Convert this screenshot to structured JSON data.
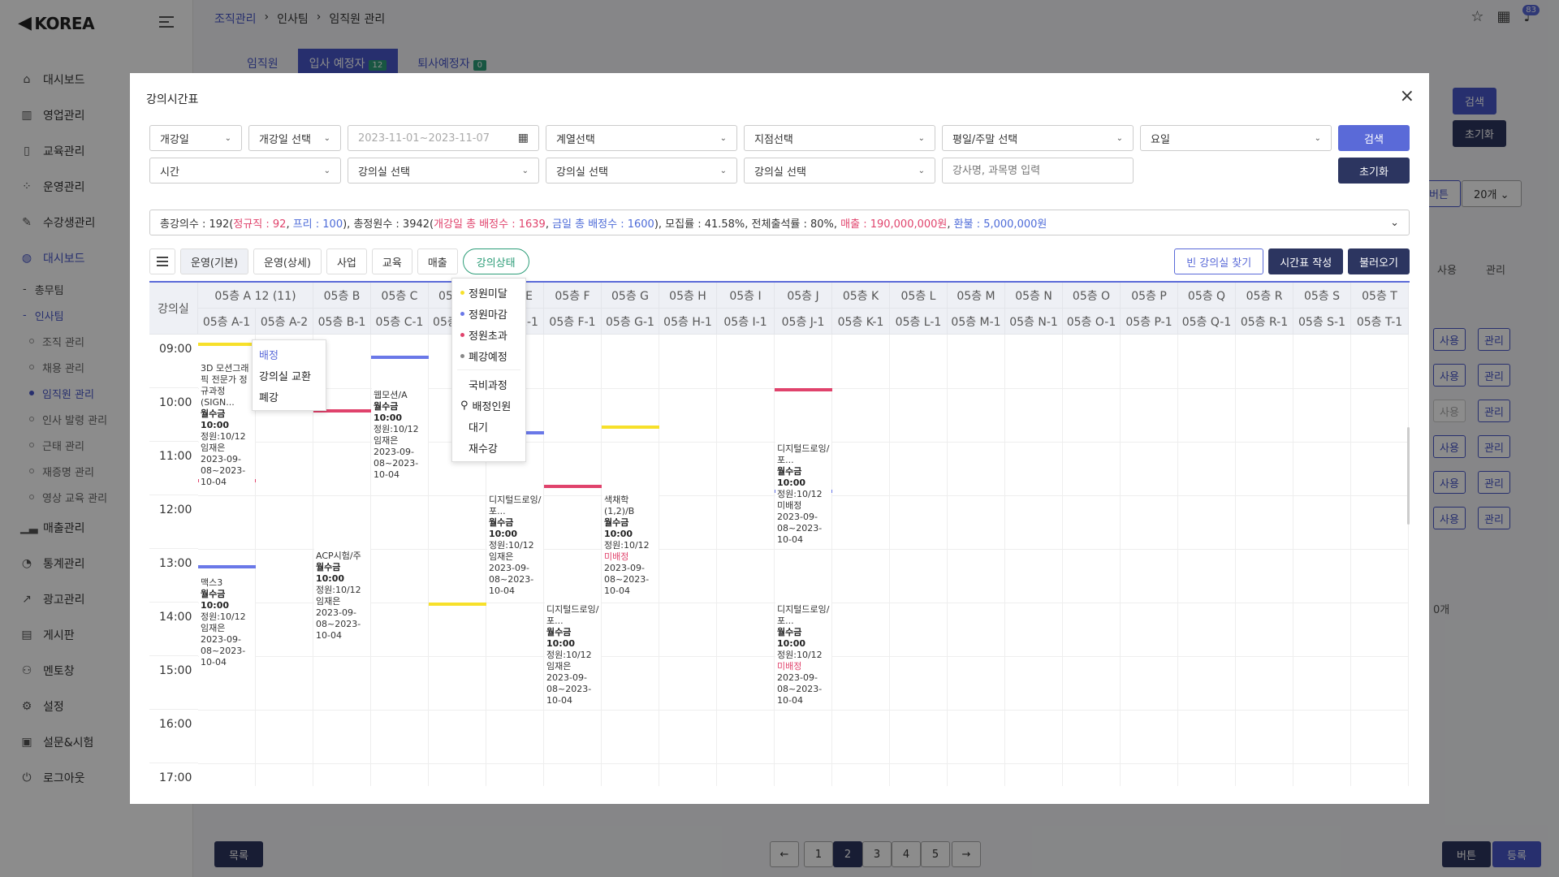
{
  "app": {
    "logo": "KOREA"
  },
  "breadcrumb": [
    "조직관리",
    "인사팀",
    "임직원 관리"
  ],
  "notifications": "83",
  "sidebar": {
    "items": [
      {
        "label": "대시보드",
        "icon": "home-icon"
      },
      {
        "label": "영업관리",
        "icon": "building-icon"
      },
      {
        "label": "교육관리",
        "icon": "book-icon"
      },
      {
        "label": "운영관리",
        "icon": "grid-icon"
      },
      {
        "label": "수강생관리",
        "icon": "edit-icon"
      },
      {
        "label": "대시보드",
        "icon": "globe-icon"
      }
    ],
    "sub": [
      "총무팀",
      "인사팀"
    ],
    "subsub": [
      "조직 관리",
      "채용 관리",
      "임직원 관리",
      "인사 발령 관리",
      "근태 관리",
      "재증명 관리",
      "영상 교육 관리"
    ],
    "items2": [
      {
        "label": "매출관리",
        "icon": "bar-chart-icon"
      },
      {
        "label": "통계관리",
        "icon": "pie-icon"
      },
      {
        "label": "광고관리",
        "icon": "trend-icon"
      },
      {
        "label": "게시판",
        "icon": "board-icon"
      },
      {
        "label": "멘토창",
        "icon": "people-icon"
      },
      {
        "label": "설정",
        "icon": "gear-icon"
      },
      {
        "label": "설문&시험",
        "icon": "survey-icon"
      },
      {
        "label": "로그아웃",
        "icon": "power-icon"
      }
    ]
  },
  "bg": {
    "tabs": [
      {
        "label": "임직원",
        "count": ""
      },
      {
        "label": "입사 예정자",
        "count": "12"
      },
      {
        "label": "퇴사예정자",
        "count": "0"
      }
    ],
    "search": "검색",
    "reset": "초기화",
    "button": "버튼",
    "pagesize": "20개",
    "col_use": "사용",
    "col_manage": "관리",
    "use": "사용",
    "manage": "관리",
    "count_label": "0개",
    "list": "목록",
    "register": "등록",
    "pages": [
      "1",
      "2",
      "3",
      "4",
      "5"
    ],
    "prev": "←",
    "next": "→"
  },
  "modal": {
    "title": "강의시간표",
    "close": "×",
    "filters": {
      "open_date": "개강일",
      "open_date_select": "개강일 선택",
      "date_range": "2023-11-01~2023-11-07",
      "series": "계열선택",
      "branch": "지점선택",
      "weekday_weekend": "평일/주말 선택",
      "day": "요일",
      "time": "시간",
      "room1": "강의실 선택",
      "room2": "강의실 선택",
      "room3": "강의실 선택",
      "keyword_placeholder": "강사명, 과목명 입력",
      "search": "검색",
      "reset": "초기화"
    },
    "summary": {
      "p1": "총강의수 : 192(",
      "regular": "정규직 : 92",
      "c1": ", ",
      "free": "프리 : 100",
      "p2": "), 총정원수 : 3942(",
      "open_total": "개강일 총 배정수 : 1639",
      "c2": ", ",
      "today_total": "금일 총 배정수 : 1600",
      "p3": "), 모집률 : 41.58%, 전체출석률 : 80%, ",
      "sales": "매출 : 190,000,000원",
      "c3": ", ",
      "refund": "환불 : 5,000,000원"
    },
    "tabs": [
      "운영(기본)",
      "운영(상세)",
      "사업",
      "교육",
      "매출",
      "강의상태"
    ],
    "actions": [
      "빈 강의실 찾기",
      "시간표 작성",
      "불러오기"
    ],
    "grid": {
      "corner": "강의실",
      "rooms": [
        "05층 A 12 (11)",
        "05층 B",
        "05층 C",
        "05층 D",
        "05층 E",
        "05층 F",
        "05층 G",
        "05층 H",
        "05층 I",
        "05층 J",
        "05층 K",
        "05층 L",
        "05층 M",
        "05층 N",
        "05층 O",
        "05층 P",
        "05층 Q",
        "05층 R",
        "05층 S",
        "05층 T"
      ],
      "subrooms": [
        "05층 A-1",
        "05층 A-2",
        "05층 B-1",
        "05층 C-1",
        "05층 D-1",
        "05층 E-1",
        "05층 F-1",
        "05층 G-1",
        "05층 H-1",
        "05층 I-1",
        "05층 J-1",
        "05층 K-1",
        "05층 L-1",
        "05층 M-1",
        "05층 N-1",
        "05층 O-1",
        "05층 P-1",
        "05층 Q-1",
        "05층 R-1",
        "05층 S-1",
        "05층 T-1"
      ],
      "times": [
        "09:00",
        "10:00",
        "11:00",
        "12:00",
        "13:00",
        "14:00",
        "15:00",
        "16:00",
        "17:00"
      ]
    },
    "events": [
      {
        "t": "3D 모션그래픽 전문가 정규과정(SIGN...",
        "d": "월수금 10:00",
        "c": "정원:10/12",
        "i": "임재은",
        "p": "2023-09-08~2023-10-04",
        "m": ""
      },
      {
        "t": "웹모션/A",
        "d": "월수금 10:00",
        "c": "정원:10/12",
        "i": "임재은",
        "p": "2023-09-08~2023-10-04",
        "m": ""
      },
      {
        "t": "맥스3",
        "d": "월수금 10:00",
        "c": "정원:10/12",
        "i": "임재은",
        "p": "2023-09-08~2023-10-04",
        "m": ""
      },
      {
        "t": "ACP시험/주",
        "d": "월수금 10:00",
        "c": "정원:10/12",
        "i": "임재은",
        "p": "2023-09-08~2023-10-04",
        "m": ""
      },
      {
        "t": "디지털드로잉/포...",
        "d": "월수금 10:00",
        "c": "정원:10/12",
        "i": "임재은",
        "p": "2023-09-08~2023-10-04",
        "m": ""
      },
      {
        "t": "색채학(1,2)/B",
        "d": "월수금 10:00",
        "c": "정원:10/12",
        "i": "",
        "p": "2023-09-08~2023-10-04",
        "m": "미배정"
      },
      {
        "t": "디지털드로잉/포...",
        "d": "월수금 10:00",
        "c": "정원:10/12",
        "i": "임재은",
        "p": "2023-09-08~2023-10-04",
        "m": ""
      },
      {
        "t": "디지털드로잉/포...",
        "d": "월수금 10:00",
        "c": "정원:10/12",
        "i": "미배정",
        "p": "2023-09-08~2023-10-04",
        "m": ""
      },
      {
        "t": "디지털드로잉/포...",
        "d": "월수금 10:00",
        "c": "정원:10/12",
        "i": "",
        "p": "2023-09-08~2023-10-04",
        "m": "미배정"
      }
    ],
    "status_menu": [
      "정원미달",
      "정원마감",
      "정원초과",
      "폐강예정",
      "국비과정",
      "배정인원",
      "대기",
      "재수강"
    ],
    "context_menu": [
      "배정",
      "강의실 교환",
      "폐강"
    ]
  },
  "colors": {
    "accent": "#4857c9",
    "yellow": "#f7e02a",
    "blue": "#6a78e8",
    "red": "#e0436c",
    "green": "#2d9d78",
    "dark": "#2c3560"
  }
}
